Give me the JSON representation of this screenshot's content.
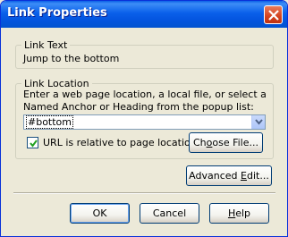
{
  "window": {
    "title": "Link Properties"
  },
  "link_text": {
    "legend": "Link Text",
    "value": "Jump to the bottom"
  },
  "link_location": {
    "legend": "Link Location",
    "instructions_line1": "Enter a web page location, a local file, or select a",
    "instructions_line2": "Named Anchor or Heading from the popup list:",
    "url_value": "#bottom",
    "checkbox_checked": true,
    "checkbox_label": "URL is relative to page location",
    "choose_file_label_pre": "Ch",
    "choose_file_label_u": "o",
    "choose_file_label_post": "ose File..."
  },
  "advanced_edit": {
    "pre": "Advanced ",
    "u": "E",
    "post": "dit..."
  },
  "footer": {
    "ok_label": "OK",
    "cancel_label": "Cancel",
    "help_u": "H",
    "help_post": "elp"
  },
  "icons": {
    "close": "close-icon",
    "dropdown": "chevron-down-icon",
    "check": "checkmark-icon"
  }
}
